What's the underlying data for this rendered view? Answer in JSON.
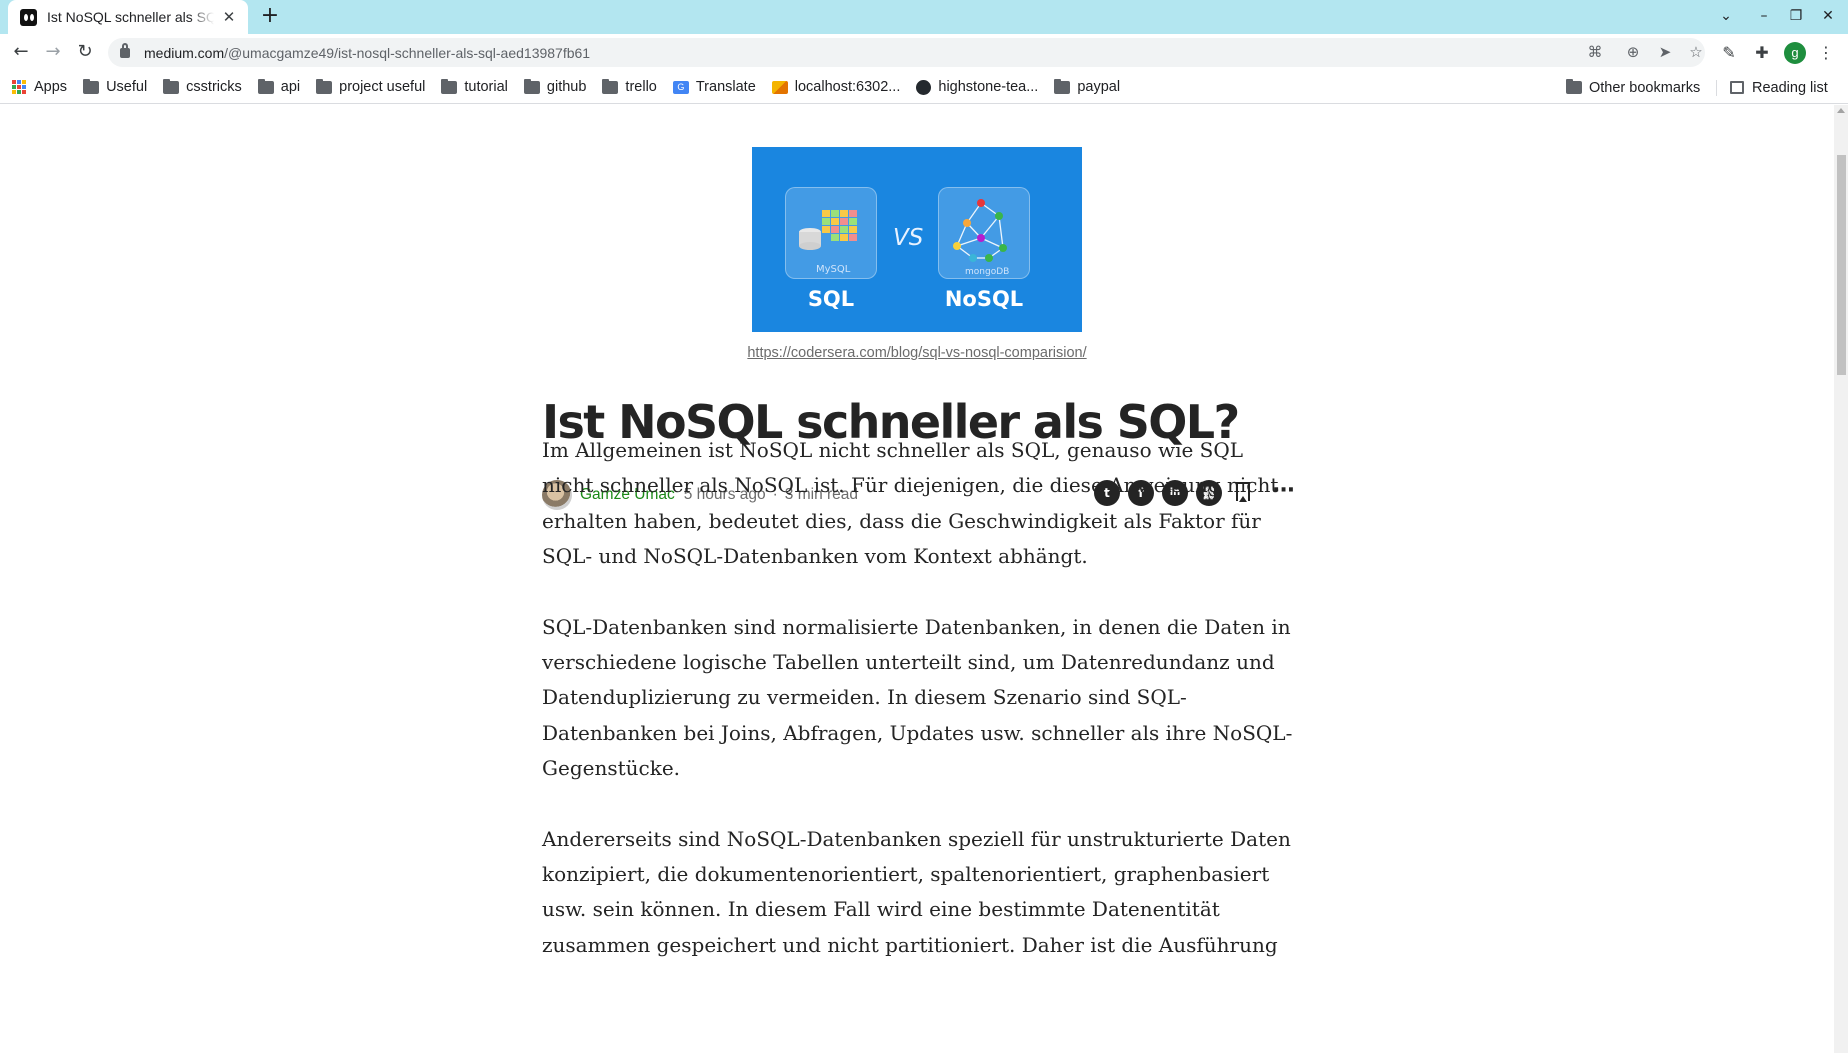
{
  "browser": {
    "tab": {
      "title": "Ist NoSQL schneller als SQL? | Medium"
    },
    "url": {
      "host": "medium.com",
      "path": "/@umacgamze49/ist-nosql-schneller-als-sql-aed13987fb61"
    },
    "profile_initial": "g",
    "bookmarks": [
      {
        "label": "Apps",
        "icon": "apps-grid-icon"
      },
      {
        "label": "Useful",
        "icon": "folder-icon"
      },
      {
        "label": "csstricks",
        "icon": "folder-icon"
      },
      {
        "label": "api",
        "icon": "folder-icon"
      },
      {
        "label": "project useful",
        "icon": "folder-icon"
      },
      {
        "label": "tutorial",
        "icon": "folder-icon"
      },
      {
        "label": "github",
        "icon": "folder-icon"
      },
      {
        "label": "trello",
        "icon": "folder-icon"
      },
      {
        "label": "Translate",
        "icon": "translate-icon"
      },
      {
        "label": "localhost:6302...",
        "icon": "localhost-icon"
      },
      {
        "label": "highstone-tea...",
        "icon": "github-icon"
      },
      {
        "label": "paypal",
        "icon": "folder-icon"
      }
    ],
    "other_bookmarks": "Other bookmarks",
    "reading_list": "Reading list"
  },
  "article": {
    "hero": {
      "left_label": "SQL",
      "vs_label": "VS",
      "right_label": "NoSQL",
      "left_sub": "MySQL",
      "right_sub": "mongoDB"
    },
    "caption": "https://codersera.com/blog/sql-vs-nosql-comparision/",
    "title": "Ist NoSQL schneller als SQL?",
    "author": "Gamze Umac",
    "published": "5 hours ago",
    "separator": "·",
    "read_time": "3 min read",
    "share": {
      "twitter": "t",
      "facebook": "f",
      "linkedin": "in",
      "link": "⛓"
    },
    "paragraphs": [
      "Im Allgemeinen ist NoSQL nicht schneller als SQL, genauso wie SQL nicht schneller als NoSQL ist. Für diejenigen, die diese Anweisung nicht erhalten haben, bedeutet dies, dass die Geschwindigkeit als Faktor für SQL- und NoSQL-Datenbanken vom Kontext abhängt.",
      "SQL-Datenbanken sind normalisierte Datenbanken, in denen die Daten in verschiedene logische Tabellen unterteilt sind, um Datenredundanz und Datenduplizierung zu vermeiden. In diesem Szenario sind SQL-Datenbanken bei Joins, Abfragen, Updates usw. schneller als ihre NoSQL-Gegenstücke.",
      "Andererseits sind NoSQL-Datenbanken speziell für unstrukturierte Daten konzipiert, die dokumentenorientiert, spaltenorientiert, graphenbasiert usw. sein können. In diesem Fall wird eine bestimmte Datenentität zusammen gespeichert und nicht partitioniert. Daher ist die Ausführung"
    ]
  },
  "colors": {
    "tabstrip": "#b3e6f0",
    "author": "#1a8917",
    "hero": "#1a86e0"
  }
}
